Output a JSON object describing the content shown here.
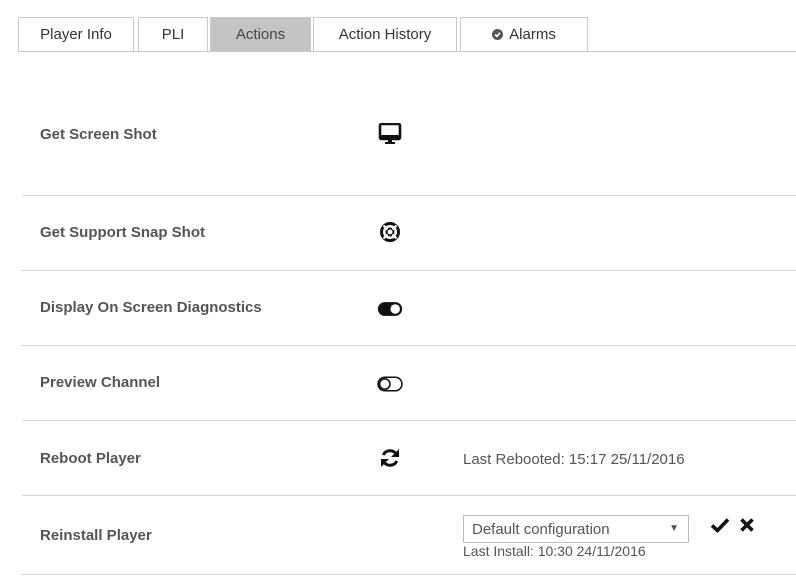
{
  "tabs": [
    {
      "label": "Player Info"
    },
    {
      "label": "PLI"
    },
    {
      "label": "Actions"
    },
    {
      "label": "Action History"
    },
    {
      "label": "Alarms"
    }
  ],
  "actions": {
    "screenshot": {
      "label": "Get Screen Shot",
      "icon": "monitor-icon"
    },
    "snapshot": {
      "label": "Get Support Snap Shot",
      "icon": "life-ring-icon"
    },
    "diagnostics": {
      "label": "Display On Screen Diagnostics",
      "icon": "toggle-on-icon"
    },
    "preview": {
      "label": "Preview Channel",
      "icon": "toggle-off-icon"
    },
    "reboot": {
      "label": "Reboot Player",
      "icon": "refresh-icon",
      "info": "Last Rebooted: 15:17 25/11/2016"
    },
    "reinstall": {
      "label": "Reinstall Player",
      "selected": "Default configuration",
      "info": "Last Install: 10:30 24/11/2016",
      "confirm_icon": "check-icon",
      "cancel_icon": "times-icon"
    }
  },
  "colors": {
    "active_tab": "#c4c4c4",
    "border": "#c8c8c8",
    "text": "#555555"
  }
}
